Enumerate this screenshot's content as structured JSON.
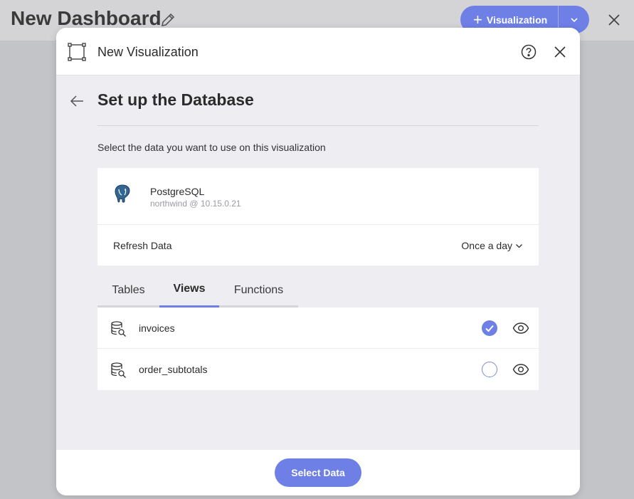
{
  "dashboard": {
    "title": "New Dashboard",
    "visualization_button_label": "Visualization"
  },
  "modal": {
    "title": "New Visualization",
    "section_title": "Set up the Database",
    "instructions": "Select the data you want to use on this visualization",
    "source": {
      "name": "PostgreSQL",
      "connection": "northwind @ 10.15.0.21",
      "icon": "postgresql-elephant-icon"
    },
    "refresh": {
      "label": "Refresh Data",
      "value": "Once a day"
    },
    "tabs": [
      {
        "label": "Tables",
        "active": false
      },
      {
        "label": "Views",
        "active": true
      },
      {
        "label": "Functions",
        "active": false
      }
    ],
    "items": [
      {
        "label": "invoices",
        "selected": true
      },
      {
        "label": "order_subtotals",
        "selected": false
      }
    ],
    "footer": {
      "select_label": "Select Data"
    }
  },
  "colors": {
    "accent": "#6e7fe6"
  }
}
